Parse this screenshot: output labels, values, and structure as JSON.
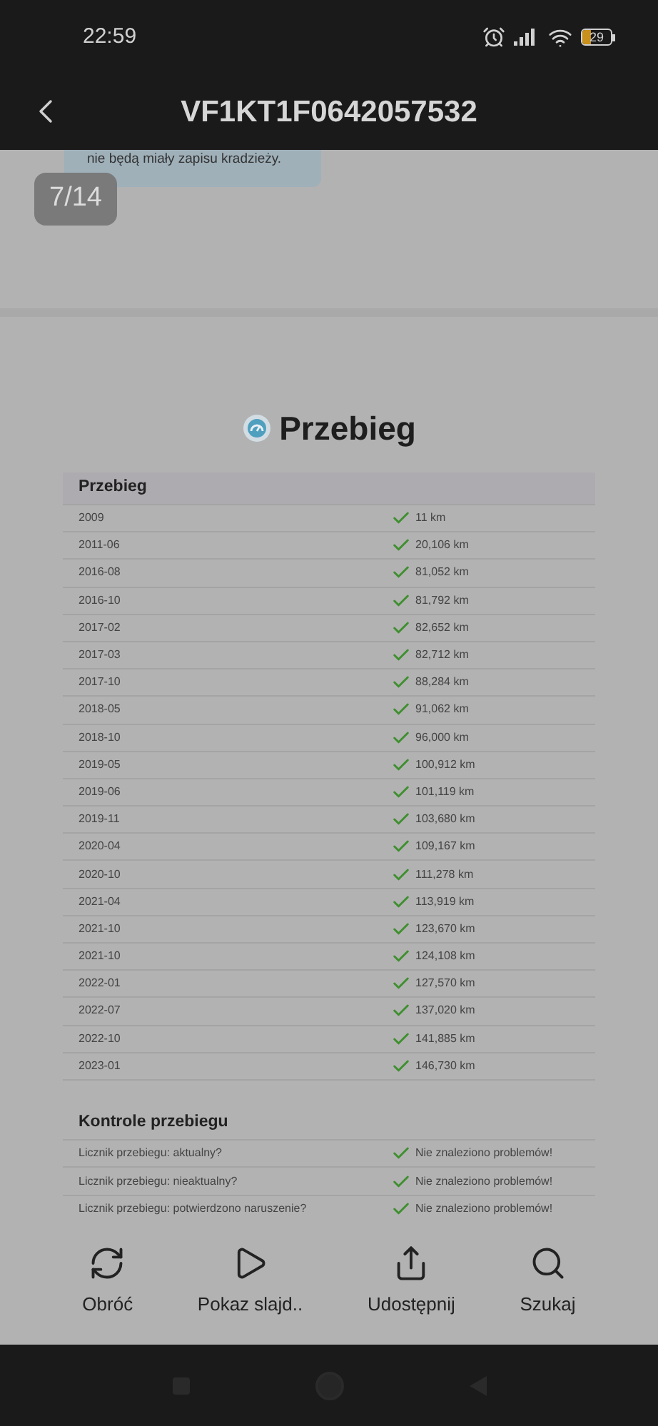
{
  "status_bar": {
    "time": "22:59",
    "battery": "29"
  },
  "header": {
    "title": "VF1KT1F0642057532"
  },
  "note": {
    "text": "nie będą miały zapisu kradzieży."
  },
  "page_counter": "7/14",
  "section_title": "Przebieg",
  "mileage_table": {
    "title": "Przebieg",
    "rows": [
      {
        "date": "2009",
        "value": "11 km"
      },
      {
        "date": "2011-06",
        "value": "20,106 km"
      },
      {
        "date": "2016-08",
        "value": "81,052 km"
      },
      {
        "date": "2016-10",
        "value": "81,792 km"
      },
      {
        "date": "2017-02",
        "value": "82,652 km"
      },
      {
        "date": "2017-03",
        "value": "82,712 km"
      },
      {
        "date": "2017-10",
        "value": "88,284 km"
      },
      {
        "date": "2018-05",
        "value": "91,062 km"
      },
      {
        "date": "2018-10",
        "value": "96,000 km"
      },
      {
        "date": "2019-05",
        "value": "100,912 km"
      },
      {
        "date": "2019-06",
        "value": "101,119 km"
      },
      {
        "date": "2019-11",
        "value": "103,680 km"
      },
      {
        "date": "2020-04",
        "value": "109,167 km"
      },
      {
        "date": "2020-10",
        "value": "111,278 km"
      },
      {
        "date": "2021-04",
        "value": "113,919 km"
      },
      {
        "date": "2021-10",
        "value": "123,670 km"
      },
      {
        "date": "2021-10",
        "value": "124,108 km"
      },
      {
        "date": "2022-01",
        "value": "127,570 km"
      },
      {
        "date": "2022-07",
        "value": "137,020 km"
      },
      {
        "date": "2022-10",
        "value": "141,885 km"
      },
      {
        "date": "2023-01",
        "value": "146,730 km"
      }
    ]
  },
  "checks_table": {
    "title": "Kontrole przebiegu",
    "rows": [
      {
        "label": "Licznik przebiegu: aktualny?",
        "result": "Nie znaleziono problemów!"
      },
      {
        "label": "Licznik przebiegu: nieaktualny?",
        "result": "Nie znaleziono problemów!"
      },
      {
        "label": "Licznik przebiegu: potwierdzono naruszenie?",
        "result": "Nie znaleziono problemów!"
      }
    ]
  },
  "toolbar": [
    {
      "kind": "rotate",
      "label": "Obróć"
    },
    {
      "kind": "play",
      "label": "Pokaz slajd.."
    },
    {
      "kind": "share",
      "label": "Udostępnij"
    },
    {
      "kind": "search",
      "label": "Szukaj"
    }
  ]
}
